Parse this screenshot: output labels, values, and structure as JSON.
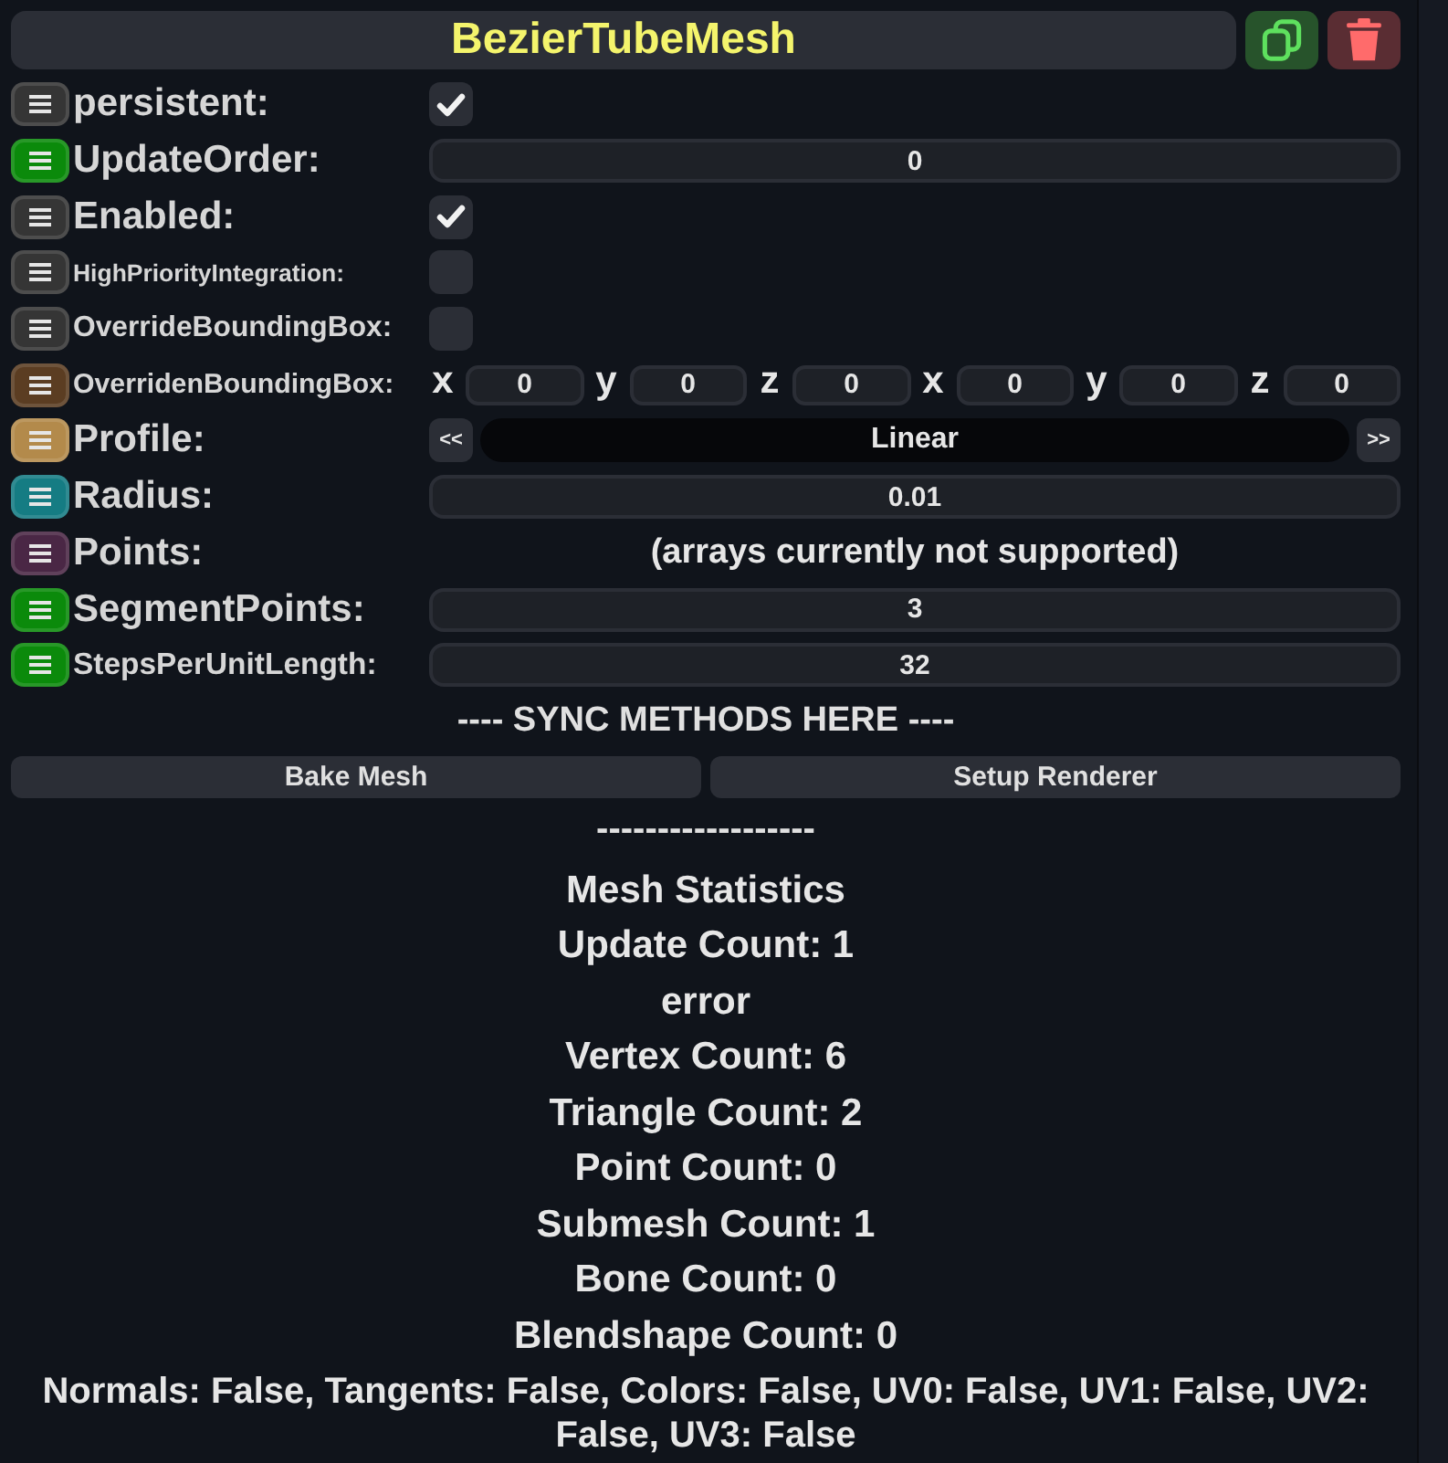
{
  "header": {
    "title": "BezierTubeMesh"
  },
  "fields": [
    {
      "label": "persistent:",
      "color": "#353535",
      "kind": "checkbox",
      "checked": true
    },
    {
      "label": "UpdateOrder:",
      "color": "#0b8a0b",
      "kind": "number",
      "value": "0"
    },
    {
      "label": "Enabled:",
      "color": "#353535",
      "kind": "checkbox",
      "checked": true
    },
    {
      "label": "HighPriorityIntegration:",
      "color": "#353535",
      "kind": "checkbox",
      "checked": false
    },
    {
      "label": "OverrideBoundingBox:",
      "color": "#353535",
      "kind": "checkbox",
      "checked": false
    },
    {
      "label": "OverridenBoundingBox:",
      "color": "#5b3d22",
      "kind": "vector",
      "components": [
        {
          "axis": "x",
          "value": "0"
        },
        {
          "axis": "y",
          "value": "0"
        },
        {
          "axis": "z",
          "value": "0"
        },
        {
          "axis": "x",
          "value": "0"
        },
        {
          "axis": "y",
          "value": "0"
        },
        {
          "axis": "z",
          "value": "0"
        }
      ]
    },
    {
      "label": "Profile:",
      "color": "#b38a4b",
      "kind": "enum",
      "prev": "<<",
      "value": "Linear",
      "next": ">>"
    },
    {
      "label": "Radius:",
      "color": "#157c83",
      "kind": "number",
      "value": "0.01"
    },
    {
      "label": "Points:",
      "color": "#4a2745",
      "kind": "note",
      "text": "(arrays currently not supported)"
    },
    {
      "label": "SegmentPoints:",
      "color": "#0b8a0b",
      "kind": "number",
      "value": "3"
    },
    {
      "label": "StepsPerUnitLength:",
      "color": "#0b8a0b",
      "kind": "number",
      "value": "32"
    }
  ],
  "sync_heading": "---- SYNC METHODS HERE ----",
  "buttons": [
    "Bake Mesh",
    "Setup Renderer"
  ],
  "separator": "------------------",
  "stats": [
    "Mesh Statistics",
    "Update Count: 1",
    "error",
    "Vertex Count: 6",
    "Triangle Count: 2",
    "Point Count: 0",
    "Submesh Count: 1",
    "Bone Count: 0",
    "Blendshape Count: 0"
  ],
  "summary": "Normals: False, Tangents: False, Colors: False, UV0: False, UV1: False, UV2: False, UV3: False"
}
